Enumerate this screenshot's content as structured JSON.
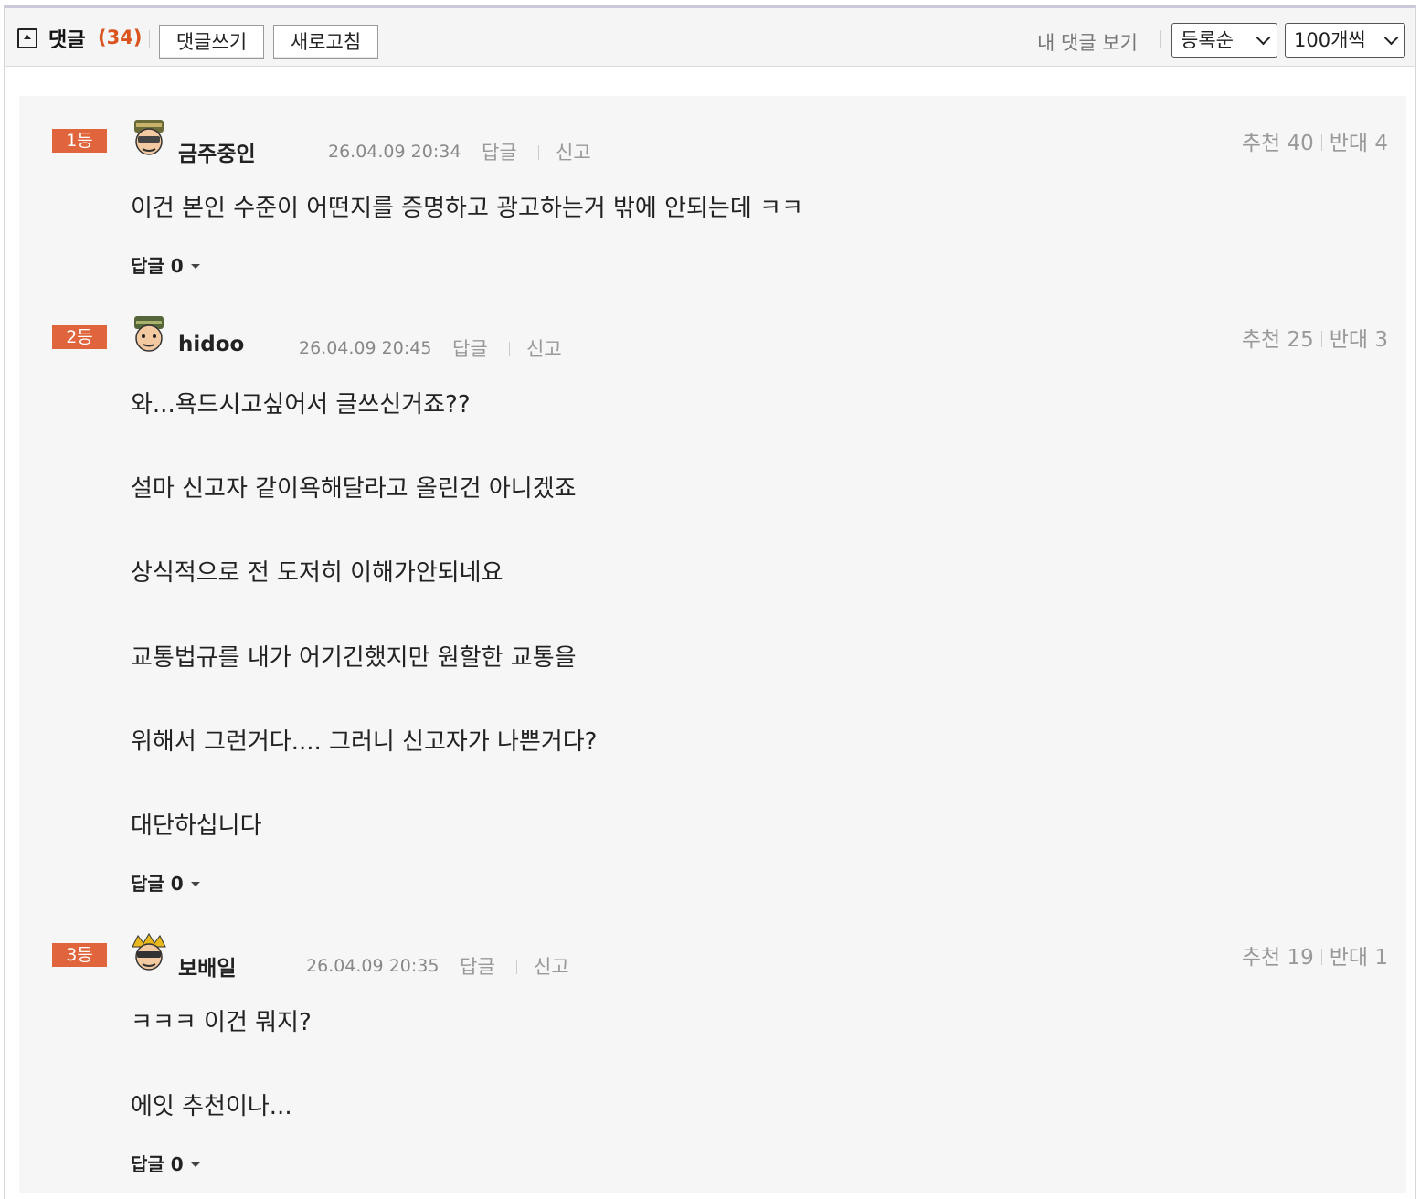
{
  "toolbar": {
    "title": "댓글",
    "count": "(34)",
    "write_button": "댓글쓰기",
    "refresh_button": "새로고침",
    "my_comments_link": "내 댓글 보기",
    "sort_select": "등록순",
    "per_page_select": "100개씩"
  },
  "comments": [
    {
      "rank": "1등",
      "nickname": "금주중인",
      "date": "26.04.09 20:34",
      "reply_link": "답글",
      "report_link": "신고",
      "recommend": "추천 40",
      "oppose": "반대 4",
      "lines": [
        "이건 본인 수준이 어떤지를 증명하고 광고하는거 밖에 안되는데 ㅋㅋ"
      ],
      "reply_count": "답글 0"
    },
    {
      "rank": "2등",
      "nickname": "hidoo",
      "date": "26.04.09 20:45",
      "reply_link": "답글",
      "report_link": "신고",
      "recommend": "추천 25",
      "oppose": "반대 3",
      "lines": [
        "와...욕드시고싶어서 글쓰신거죠??",
        "설마 신고자 같이욕해달라고 올린건 아니겠죠",
        "상식적으로 전 도저히 이해가안되네요",
        "교통법규를 내가 어기긴했지만 원할한 교통을",
        "위해서 그런거다.... 그러니 신고자가 나쁜거다?",
        "대단하십니다"
      ],
      "reply_count": "답글 0"
    },
    {
      "rank": "3등",
      "nickname": "보배일",
      "date": "26.04.09 20:35",
      "reply_link": "답글",
      "report_link": "신고",
      "recommend": "추천 19",
      "oppose": "반대 1",
      "lines": [
        "ㅋㅋㅋ 이건 뭐지?",
        "에잇 추천이나..."
      ],
      "reply_count": "답글 0"
    }
  ],
  "colors": {
    "rank_badge": "#e0643c",
    "count_accent": "#d9541e",
    "list_background": "#f6f6f6"
  }
}
